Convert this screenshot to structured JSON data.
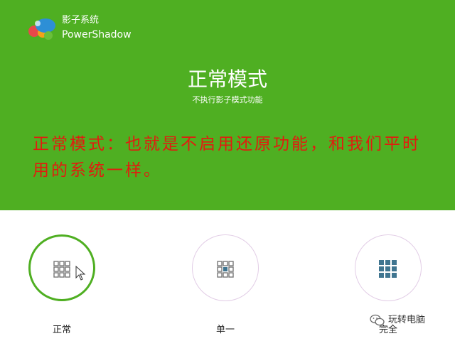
{
  "header": {
    "app_name": "影子系统",
    "app_name_en": "PowerShadow",
    "mode_title": "正常模式",
    "mode_subtitle": "不执行影子模式功能"
  },
  "annotation": {
    "text": "正常模式：也就是不启用还原功能，和我们平时用的系统一样。",
    "color": "#e21b0f"
  },
  "modes": [
    {
      "label": "正常",
      "selected": true,
      "icon": "grid-outline-icon"
    },
    {
      "label": "单一",
      "selected": false,
      "icon": "grid-center-filled-icon"
    },
    {
      "label": "完全",
      "selected": false,
      "icon": "grid-filled-icon"
    }
  ],
  "watermark": {
    "text": "玩转电脑",
    "icon": "wechat-icon"
  },
  "colors": {
    "header_bg": "#4faf22",
    "selected_ring": "#4faf22",
    "unselected_ring": "#e2cde6",
    "grid_fill": "#3f7590",
    "grid_outline": "#777777"
  }
}
